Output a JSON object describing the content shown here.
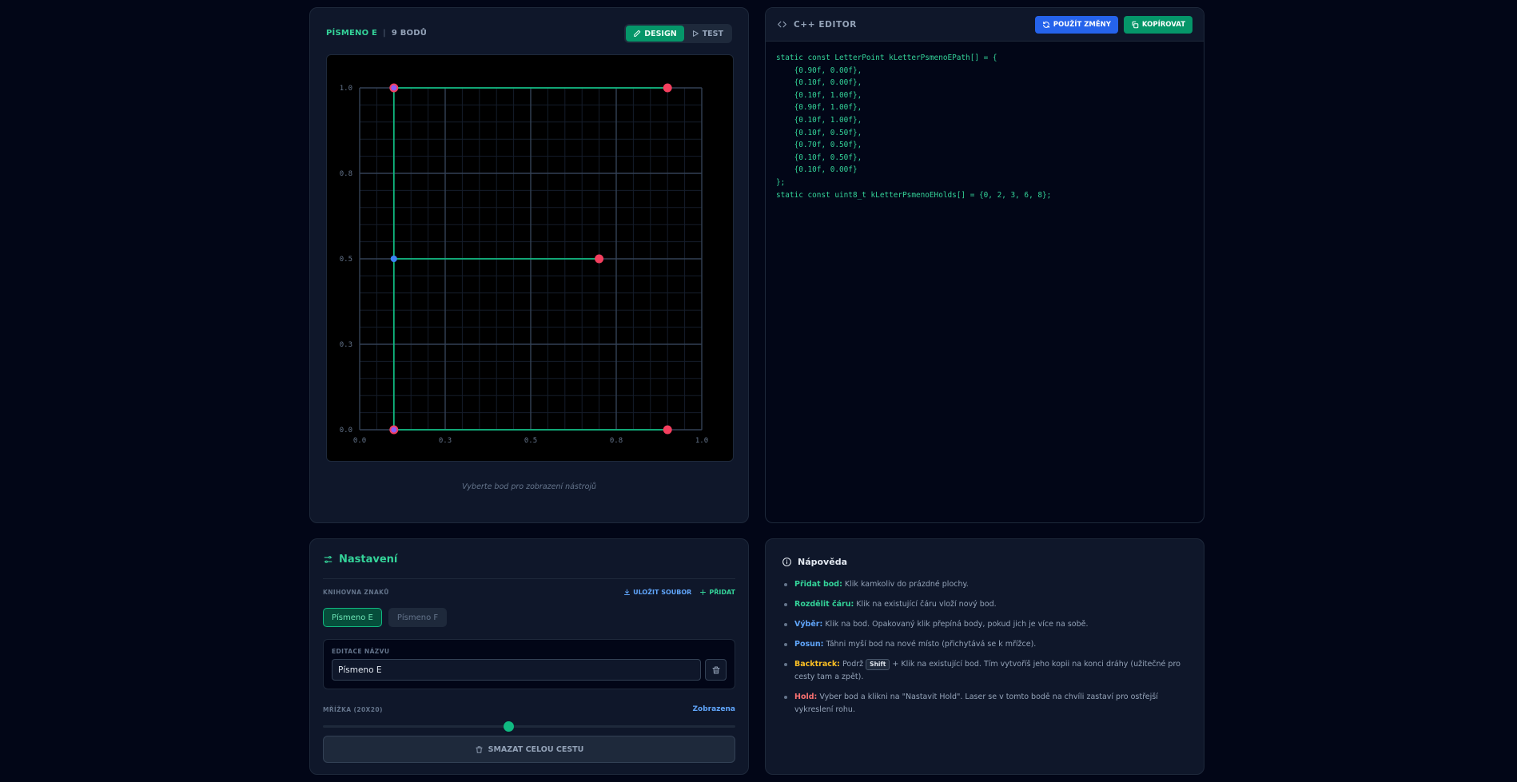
{
  "design": {
    "letter_name": "PÍSMENO E",
    "points_label": "9 BODŮ",
    "tab_design": "DESIGN",
    "tab_test": "TEST",
    "hint": "Vyberte bod pro zobrazení nástrojů"
  },
  "canvas": {
    "tick_labels": [
      "0.0",
      "0.3",
      "0.5",
      "0.8",
      "1.0"
    ],
    "path": [
      [
        0.9,
        0.0
      ],
      [
        0.1,
        0.0
      ],
      [
        0.1,
        1.0
      ],
      [
        0.9,
        1.0
      ],
      [
        0.1,
        1.0
      ],
      [
        0.1,
        0.5
      ],
      [
        0.7,
        0.5
      ],
      [
        0.1,
        0.5
      ],
      [
        0.1,
        0.0
      ]
    ],
    "holds": [
      0,
      2,
      3,
      6,
      8
    ],
    "colors": {
      "path": "#10b981",
      "hold": "#f43f5e",
      "point": "#3b82f6",
      "grid_major": "#334155",
      "grid_minor": "#151d2b"
    }
  },
  "editor": {
    "title": "C++ EDITOR",
    "apply_label": "POUŽÍT ZMĚNY",
    "copy_label": "KOPÍROVAT",
    "code": "static const LetterPoint kLetterPsmenoEPath[] = {\n    {0.90f, 0.00f},\n    {0.10f, 0.00f},\n    {0.10f, 1.00f},\n    {0.90f, 1.00f},\n    {0.10f, 1.00f},\n    {0.10f, 0.50f},\n    {0.70f, 0.50f},\n    {0.10f, 0.50f},\n    {0.10f, 0.00f}\n};\nstatic const uint8_t kLetterPsmenoEHolds[] = {0, 2, 3, 6, 8};"
  },
  "settings": {
    "title": "Nastavení",
    "library_label": "KNIHOVNA ZNAKŮ",
    "save_file_label": "ULOŽIT SOUBOR",
    "add_label": "PŘIDAT",
    "chips": [
      "Písmeno E",
      "Písmeno F"
    ],
    "name_edit_label": "EDITACE NÁZVU",
    "name_value": "Písmeno E",
    "grid_label": "MŘÍŽKA (20X20)",
    "grid_state": "Zobrazena",
    "grid_slider_fraction": 0.45,
    "clear_label": "SMAZAT CELOU CESTU"
  },
  "help": {
    "title": "Nápověda",
    "items": [
      {
        "term": "Přidat bod:",
        "text": " Klik kamkoliv do prázdné plochy.",
        "color": "#34d399"
      },
      {
        "term": "Rozdělit čáru:",
        "text": " Klik na existující čáru vloží nový bod.",
        "color": "#34d399"
      },
      {
        "term": "Výběr:",
        "text": " Klik na bod. Opakovaný klik přepíná body, pokud jich je více na sobě.",
        "color": "#60a5fa"
      },
      {
        "term": "Posun:",
        "text": " Táhni myší bod na nové místo (přichytává se k mřížce).",
        "color": "#60a5fa"
      },
      {
        "term": "Backtrack:",
        "pre": " Podrž ",
        "key": "Shift",
        "text": " + Klik na existující bod. Tím vytvoříš jeho kopii na konci dráhy (užitečné pro cesty tam a zpět).",
        "color": "#fbbf24"
      },
      {
        "term": "Hold:",
        "text": " Vyber bod a klikni na \"Nastavit Hold\". Laser se v tomto bodě na chvíli zastaví pro ostřejší vykreslení rohu.",
        "color": "#f87171"
      }
    ]
  }
}
